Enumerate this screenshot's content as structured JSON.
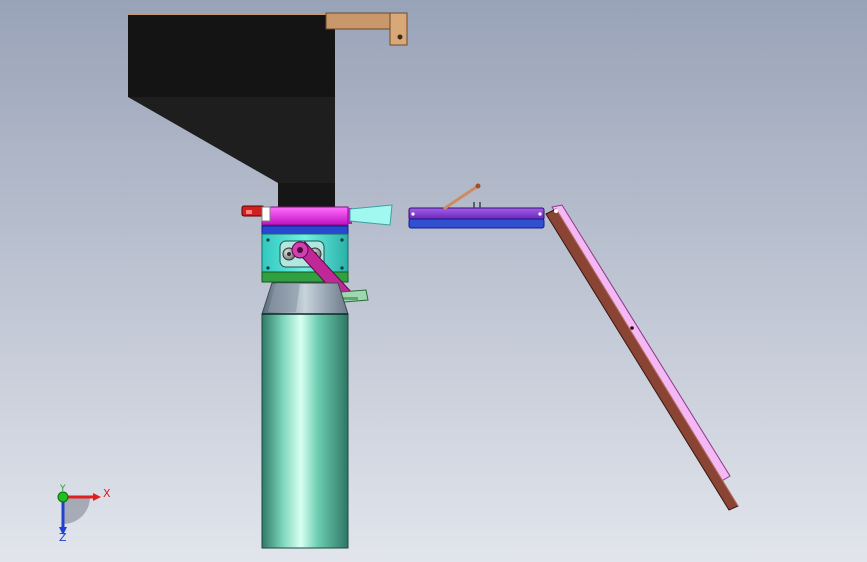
{
  "viewport": {
    "background_top": "#9aa3b8",
    "background_bottom": "#dfe2ea"
  },
  "triad": {
    "x_label": "X",
    "y_label": "Y",
    "z_label": "Z",
    "x_color": "#e02020",
    "y_color": "#20c020",
    "z_color": "#2040d0"
  },
  "colors": {
    "hopper": "#141414",
    "bracket": "#c8976a",
    "magenta": "#e030e0",
    "purple": "#8a3ad0",
    "blue": "#3050d0",
    "cyan": "#40e0d0",
    "green": "#30b040",
    "crank": "#b02088",
    "column": "#5cc0a0",
    "chute_pink": "#f0b0f0",
    "chute_brown": "#7a3828",
    "red": "#d02020"
  }
}
